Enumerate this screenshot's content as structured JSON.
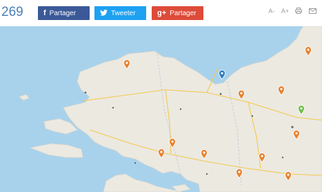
{
  "share": {
    "count": "269",
    "facebook_label": "Partager",
    "twitter_label": "Tweeter",
    "googleplus_label": "Partager",
    "facebook_icon": "f",
    "googleplus_icon": "g+"
  },
  "tools": {
    "font_decrease": "A-",
    "font_increase": "A+",
    "print_icon": "print-icon",
    "email_icon": "email-icon"
  },
  "map": {
    "marker_colors": {
      "orange": "#e8822f",
      "blue": "#2e7bbf",
      "green": "#6fbf4a"
    },
    "markers": [
      {
        "color": "orange"
      },
      {
        "color": "orange"
      },
      {
        "color": "blue"
      },
      {
        "color": "orange"
      },
      {
        "color": "orange"
      },
      {
        "color": "green"
      },
      {
        "color": "orange"
      },
      {
        "color": "orange"
      },
      {
        "color": "orange"
      },
      {
        "color": "orange"
      },
      {
        "color": "orange"
      },
      {
        "color": "orange"
      },
      {
        "color": "orange"
      }
    ]
  }
}
